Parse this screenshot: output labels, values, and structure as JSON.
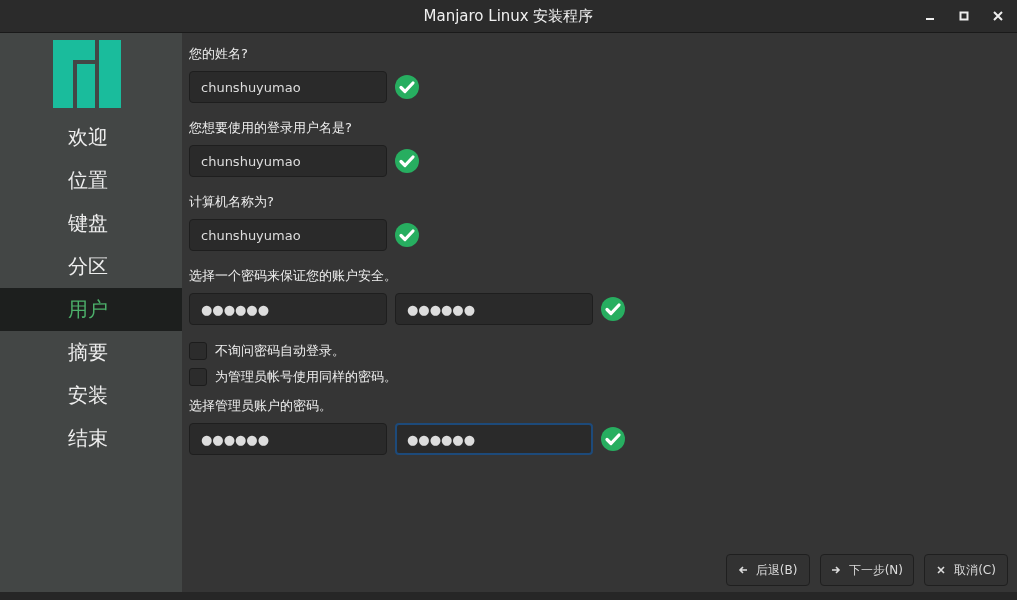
{
  "window": {
    "title": "Manjaro Linux 安装程序"
  },
  "sidebar": {
    "items": [
      {
        "label": "欢迎",
        "selected": false
      },
      {
        "label": "位置",
        "selected": false
      },
      {
        "label": "键盘",
        "selected": false
      },
      {
        "label": "分区",
        "selected": false
      },
      {
        "label": "用户",
        "selected": true
      },
      {
        "label": "摘要",
        "selected": false
      },
      {
        "label": "安装",
        "selected": false
      },
      {
        "label": "结束",
        "selected": false
      }
    ]
  },
  "form": [
    {
      "kind": "fields",
      "label": "您的姓名?",
      "valid": true,
      "fields": [
        {
          "value": "chunshuyumao",
          "focused": false
        }
      ]
    },
    {
      "kind": "fields",
      "label": "您想要使用的登录用户名是?",
      "valid": true,
      "fields": [
        {
          "value": "chunshuyumao",
          "focused": false
        }
      ]
    },
    {
      "kind": "fields",
      "label": "计算机名称为?",
      "valid": true,
      "fields": [
        {
          "value": "chunshuyumao",
          "focused": false
        }
      ]
    },
    {
      "kind": "fields",
      "label": "选择一个密码来保证您的账户安全。",
      "valid": true,
      "fields": [
        {
          "value": "●●●●●●",
          "focused": false
        },
        {
          "value": "●●●●●●",
          "focused": false
        }
      ]
    },
    {
      "kind": "checkbox",
      "label": "不询问密码自动登录。",
      "checked": false
    },
    {
      "kind": "checkbox",
      "label": "为管理员帐号使用同样的密码。",
      "checked": false
    },
    {
      "kind": "fields",
      "label": "选择管理员账户的密码。",
      "valid": true,
      "fields": [
        {
          "value": "●●●●●●",
          "focused": false
        },
        {
          "value": "●●●●●●",
          "focused": true
        }
      ]
    }
  ],
  "buttons": [
    {
      "label": "后退(B)"
    },
    {
      "label": "下一步(N)"
    },
    {
      "label": "取消(C)"
    }
  ]
}
